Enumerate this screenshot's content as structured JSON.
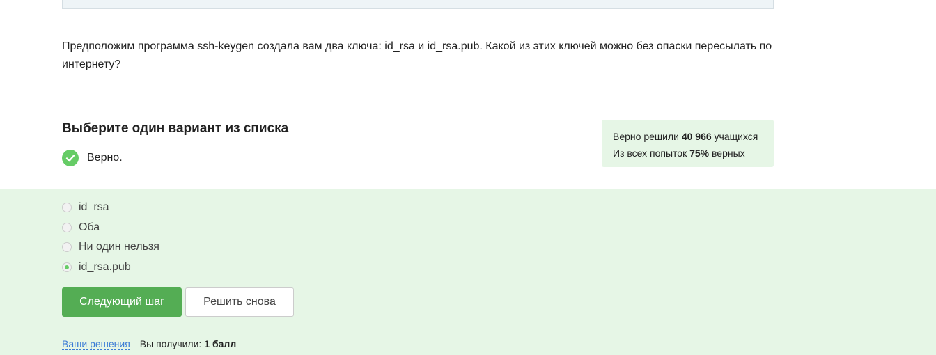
{
  "question": {
    "text": "Предположим программа ssh-keygen создала вам два ключа: id_rsa и id_rsa.pub. Какой из этих ключей можно без опаски пересылать по интернету?"
  },
  "answer_section": {
    "title": "Выберите один вариант из списка",
    "status": "Верно.",
    "status_color": "#66cc66"
  },
  "stats": {
    "line1_prefix": "Верно решили",
    "solved_count": "40 966",
    "line1_suffix": "учащихся",
    "line2_prefix": "Из всех попыток",
    "percent": "75%",
    "line2_suffix": "верных"
  },
  "options": [
    {
      "label": "id_rsa",
      "selected": false
    },
    {
      "label": "Оба",
      "selected": false
    },
    {
      "label": "Ни один нельзя",
      "selected": false
    },
    {
      "label": "id_rsa.pub",
      "selected": true
    }
  ],
  "buttons": {
    "next": "Следующий шаг",
    "retry": "Решить снова"
  },
  "footer": {
    "solutions_link": "Ваши решения",
    "score_label": "Вы получили:",
    "score_value": "1 балл"
  },
  "colors": {
    "accent_green": "#54ad54",
    "panel_green": "#e6f6e6",
    "link_blue": "#3a7bd5"
  }
}
